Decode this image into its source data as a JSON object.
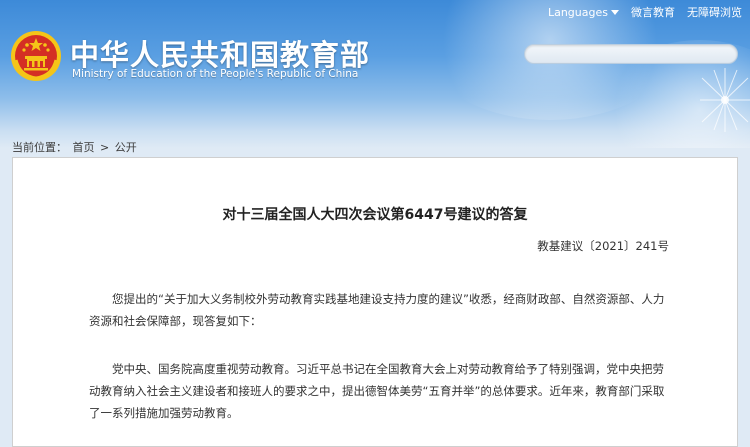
{
  "header": {
    "site_title": "中华人民共和国教育部",
    "site_subtitle": "Ministry of Education of the People's Republic of China",
    "top_links": {
      "languages": "Languages",
      "weibo": "微言教育",
      "accessible": "无障碍浏览"
    },
    "search_placeholder": ""
  },
  "breadcrumb": {
    "prefix": "当前位置：",
    "home": "首页",
    "sep": ">",
    "current": "公开"
  },
  "document": {
    "title": "对十三届全国人大四次会议第6447号建议的答复",
    "number": "教基建议〔2021〕241号",
    "para1_line1": "您提出的“关于加大义务制校外劳动教育实践基地建设支持力度的建议”收悉，经商财政部、自然资源部、人力",
    "para1_line2": "资源和社会保障部，现答复如下：",
    "para2_line1": "党中央、国务院高度重视劳动教育。习近平总书记在全国教育大会上对劳动教育给予了特别强调，党中央把劳",
    "para2_line2": "动教育纳入社会主义建设者和接班人的要求之中，提出德智体美劳“五育并举”的总体要求。近年来，教育部门采取",
    "para2_line3": "了一系列措施加强劳动教育。"
  },
  "colors": {
    "header_top": "#3d8ad8",
    "header_bottom": "#dfeaf5",
    "page_bg": "#dfeaf5",
    "emblem_red": "#d42f24",
    "emblem_gold": "#f5c518"
  }
}
